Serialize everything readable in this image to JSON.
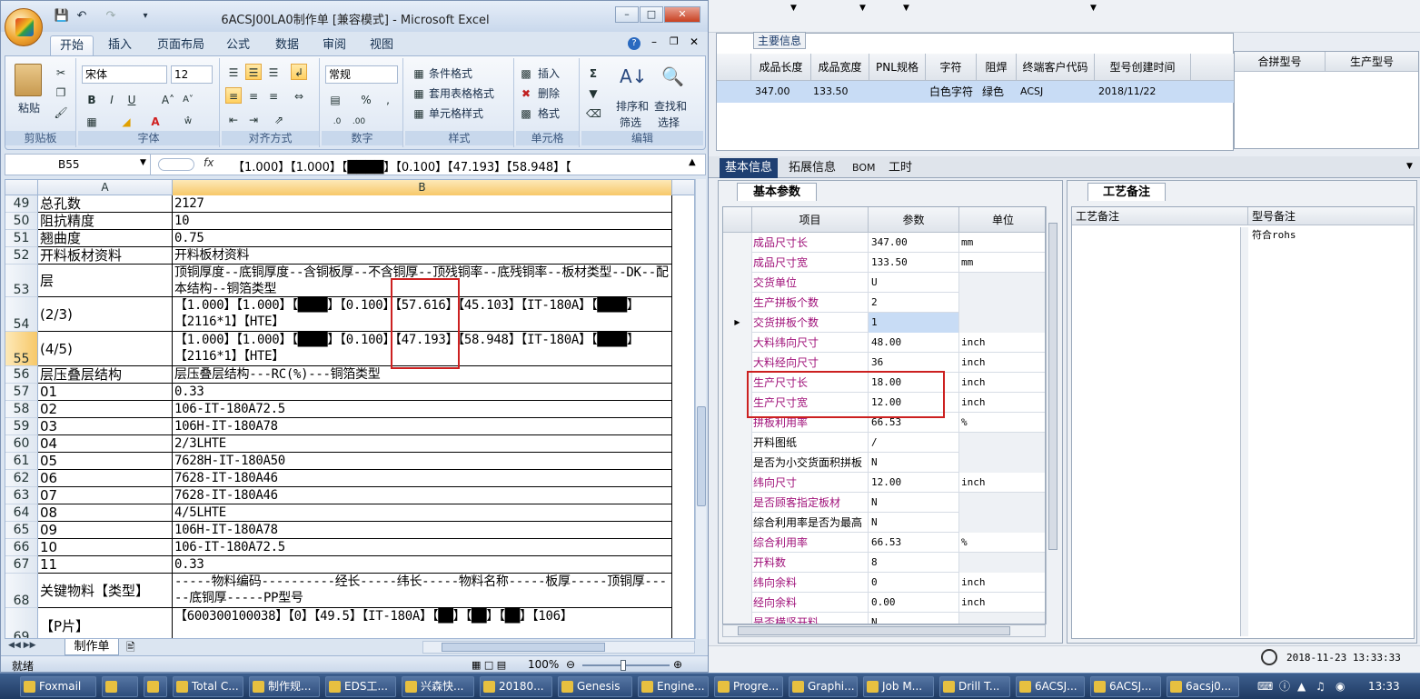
{
  "excel": {
    "window_title": "6ACSJ00LA0制作单  [兼容模式] - Microsoft Excel",
    "ribbon_tabs": [
      "开始",
      "插入",
      "页面布局",
      "公式",
      "数据",
      "审阅",
      "视图"
    ],
    "clipboard": {
      "paste": "粘贴",
      "group": "剪贴板"
    },
    "font": {
      "name": "宋体",
      "size": "12",
      "group": "字体"
    },
    "alignment": {
      "group": "对齐方式"
    },
    "number": {
      "format": "常规",
      "group": "数字"
    },
    "styles": {
      "conditional": "条件格式",
      "table": "套用表格格式",
      "cell": "单元格样式",
      "group": "样式"
    },
    "cells": {
      "insert": "插入",
      "delete": "删除",
      "format": "格式",
      "group": "单元格"
    },
    "editing": {
      "sort": "排序和",
      "filter": "筛选",
      "find": "查找和",
      "select": "选择",
      "group": "编辑"
    },
    "name_box": "B55",
    "fx": "fx",
    "formula": "【1.000】【1.000】【████】【0.100】【47.193】【58.948】【",
    "col_a": "A",
    "col_b": "B",
    "rows": [
      {
        "n": "49",
        "a": "总孔数",
        "b": "2127"
      },
      {
        "n": "50",
        "a": "阻抗精度",
        "b": "10"
      },
      {
        "n": "51",
        "a": "翘曲度",
        "b": "0.75"
      },
      {
        "n": "52",
        "a": "开料板材资料",
        "b": "开料板材资料"
      },
      {
        "n": "53",
        "a": "层",
        "b": "顶铜厚度--底铜厚度--含铜板厚--不含铜厚--顶残铜率--底残铜率--板材类型--DK--配本结构--铜箔类型"
      },
      {
        "n": "54",
        "a": "(2/3)",
        "b": "【1.000】【1.000】【████】【0.100】【57.616】【45.103】【IT-180A】【████】【2116*1】【HTE】"
      },
      {
        "n": "55",
        "a": "(4/5)",
        "b": "【1.000】【1.000】【████】【0.100】【47.193】【58.948】【IT-180A】【████】【2116*1】【HTE】"
      },
      {
        "n": "56",
        "a": "层压叠层结构",
        "b": "层压叠层结构---RC(%)---铜箔类型"
      },
      {
        "n": "57",
        "a": "01",
        "b": "0.33"
      },
      {
        "n": "58",
        "a": "02",
        "b": "106-IT-180A72.5"
      },
      {
        "n": "59",
        "a": "03",
        "b": "106H-IT-180A78"
      },
      {
        "n": "60",
        "a": "04",
        "b": "2/3LHTE"
      },
      {
        "n": "61",
        "a": "05",
        "b": "7628H-IT-180A50"
      },
      {
        "n": "62",
        "a": "06",
        "b": "7628-IT-180A46"
      },
      {
        "n": "63",
        "a": "07",
        "b": "7628-IT-180A46"
      },
      {
        "n": "64",
        "a": "08",
        "b": "4/5LHTE"
      },
      {
        "n": "65",
        "a": "09",
        "b": "106H-IT-180A78"
      },
      {
        "n": "66",
        "a": "10",
        "b": "106-IT-180A72.5"
      },
      {
        "n": "67",
        "a": "11",
        "b": "0.33"
      },
      {
        "n": "68",
        "a": "关键物料【类型】",
        "b": "-----物料编码----------经长-----纬长-----物料名称-----板厚-----顶铜厚-----底铜厚-----PP型号"
      },
      {
        "n": "69",
        "a": "【P片】",
        "b": "【600300100038】【0】【49.5】【IT-180A】【██】【██】【██】【106】"
      }
    ],
    "sheet_tab": "制作单",
    "status_left": "就绪",
    "zoom": "100%"
  },
  "app": {
    "main_info_label": "主要信息",
    "main_headers": [
      "成品长度",
      "成品宽度",
      "PNL规格",
      "字符",
      "阻焊",
      "终端客户代码",
      "型号创建时间"
    ],
    "main_values": [
      "347.00",
      "133.50",
      "",
      "白色字符",
      "绿色",
      "ACSJ",
      "2018/11/22"
    ],
    "side_headers": [
      "合拼型号",
      "生产型号"
    ],
    "tabs": [
      "基本信息",
      "拓展信息",
      "BOM",
      "工时"
    ],
    "params_tab": "基本参数",
    "params_headers": [
      "项目",
      "参数",
      "单位"
    ],
    "params": [
      {
        "item": "成品尺寸长",
        "value": "347.00",
        "unit": "mm",
        "plain": false
      },
      {
        "item": "成品尺寸宽",
        "value": "133.50",
        "unit": "mm",
        "plain": false
      },
      {
        "item": "交货单位",
        "value": "U",
        "unit": "",
        "plain": false
      },
      {
        "item": "生产拼板个数",
        "value": "2",
        "unit": "",
        "plain": false
      },
      {
        "item": "交货拼板个数",
        "value": "1",
        "unit": "",
        "plain": false
      },
      {
        "item": "大料纬向尺寸",
        "value": "48.00",
        "unit": "inch",
        "plain": false
      },
      {
        "item": "大料经向尺寸",
        "value": "36",
        "unit": "inch",
        "plain": false
      },
      {
        "item": "生产尺寸长",
        "value": "18.00",
        "unit": "inch",
        "plain": false
      },
      {
        "item": "生产尺寸宽",
        "value": "12.00",
        "unit": "inch",
        "plain": false
      },
      {
        "item": "拼板利用率",
        "value": "66.53",
        "unit": "%",
        "plain": false
      },
      {
        "item": "开料图纸",
        "value": "/",
        "unit": "",
        "plain": true
      },
      {
        "item": "是否为小交货面积拼板",
        "value": "N",
        "unit": "",
        "plain": true
      },
      {
        "item": "纬向尺寸",
        "value": "12.00",
        "unit": "inch",
        "plain": false
      },
      {
        "item": "是否顾客指定板材",
        "value": "N",
        "unit": "",
        "plain": false
      },
      {
        "item": "综合利用率是否为最高",
        "value": "N",
        "unit": "",
        "plain": true
      },
      {
        "item": "综合利用率",
        "value": "66.53",
        "unit": "%",
        "plain": false
      },
      {
        "item": "开料数",
        "value": "8",
        "unit": "",
        "plain": false
      },
      {
        "item": "纬向余料",
        "value": "0",
        "unit": "inch",
        "plain": false
      },
      {
        "item": "经向余料",
        "value": "0.00",
        "unit": "inch",
        "plain": false
      },
      {
        "item": "是否横竖开料",
        "value": "N",
        "unit": "",
        "plain": false
      }
    ],
    "remarks_tab": "工艺备注",
    "remarks_headers": [
      "工艺备注",
      "型号备注"
    ],
    "model_remark": "符合rohs",
    "datetime": "2018-11-23 13:33:33"
  },
  "taskbar": {
    "items": [
      "Foxmail",
      "",
      "",
      "Total C...",
      "制作规...",
      "EDS工...",
      "兴森快...",
      "20180...",
      "Genesis",
      "Engine...",
      "Progre...",
      "Graphi...",
      "Job M...",
      "Drill T...",
      "6ACSJ...",
      "6ACSJ...",
      "6acsj0..."
    ],
    "clock": "13:33"
  }
}
